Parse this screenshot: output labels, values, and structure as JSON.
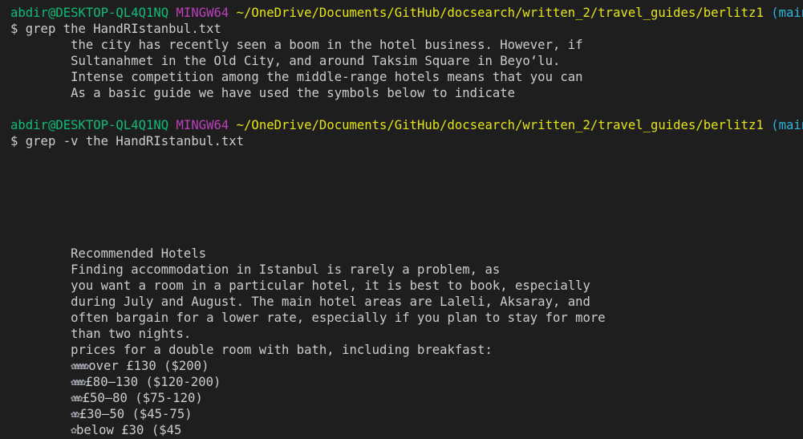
{
  "terminal": {
    "block1": {
      "prompt": {
        "user_host": "abdir@DESKTOP-QL4Q1NQ",
        "env": "MINGW64",
        "path": "~/OneDrive/Documents/GitHub/docsearch/written_2/travel_guides/berlitz1",
        "branch": "(main)"
      },
      "command": "$ grep the HandRIstanbul.txt",
      "output": [
        "        the city has recently seen a boom in the hotel business. However, if",
        "        Sultanahmet in the Old City, and around Taksim Square in Beyo‘lu.",
        "        Intense competition among the middle-range hotels means that you can",
        "        As a basic guide we have used the symbols below to indicate"
      ]
    },
    "block2": {
      "prompt": {
        "user_host": "abdir@DESKTOP-QL4Q1NQ",
        "env": "MINGW64",
        "path": "~/OneDrive/Documents/GitHub/docsearch/written_2/travel_guides/berlitz1",
        "branch": "(main)"
      },
      "command": "$ grep -v the HandRIstanbul.txt",
      "output": [
        "        Recommended Hotels",
        "        Finding accommodation in Istanbul is rarely a problem, as",
        "        you want a room in a particular hotel, it is best to book, especially",
        "        during July and August. The main hotel areas are Laleli, Aksaray, and",
        "        often bargain for a lower rate, especially if you plan to stay for more",
        "        than two nights.",
        "        prices for a double room with bath, including breakfast:"
      ],
      "price_rows": [
        {
          "icons": "✿✿✿✿✿",
          "text": "over £130 ($200)"
        },
        {
          "icons": "✿✿✿✿",
          "text": "£80–130 ($120-200)"
        },
        {
          "icons": "✿✿✿",
          "text": "£50–80 ($75-120)"
        },
        {
          "icons": "✿✿",
          "text": "£30–50 ($45-75)"
        },
        {
          "icons": "✿",
          "text": "below £30 ($45"
        }
      ]
    }
  },
  "icons": {
    "price_symbol": "gear-icon"
  },
  "colors": {
    "background": "#1e1e1e",
    "text": "#cccccc",
    "user_host": "#0dbc79",
    "env": "#bc3fbc",
    "path": "#e5e510",
    "branch": "#29b8db"
  }
}
